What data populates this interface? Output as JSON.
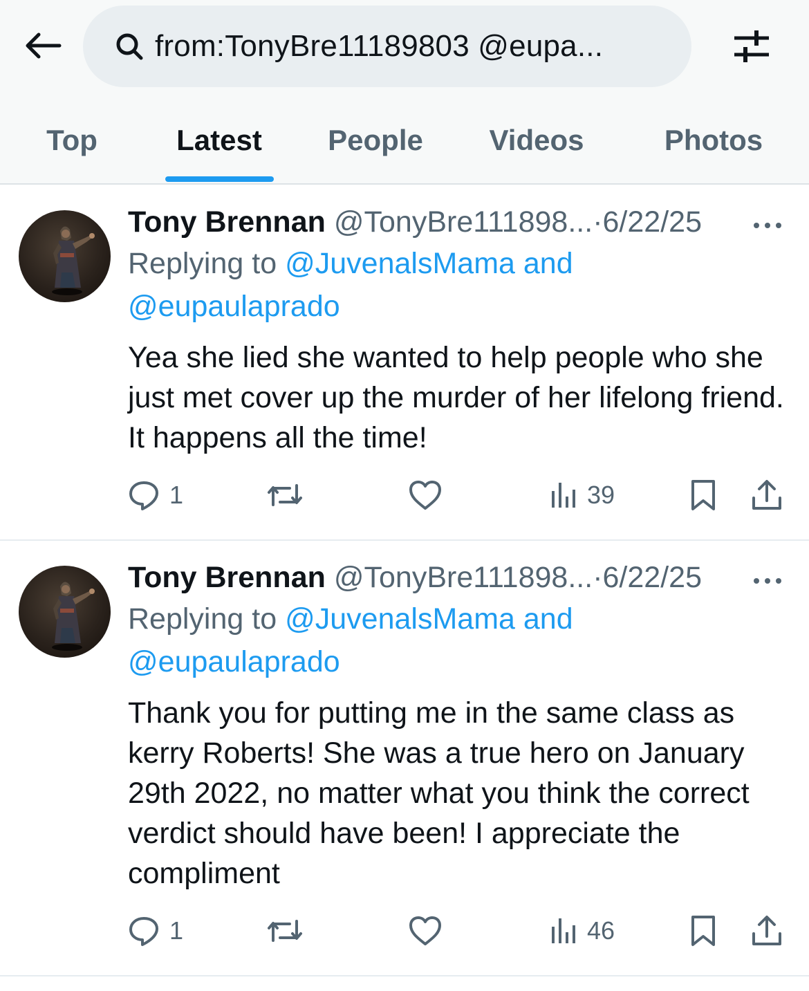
{
  "search": {
    "query": "from:TonyBre11189803 @eupa..."
  },
  "tabs": [
    {
      "label": "Top"
    },
    {
      "label": "Latest"
    },
    {
      "label": "People"
    },
    {
      "label": "Videos"
    },
    {
      "label": "Photos"
    }
  ],
  "active_tab": "Latest",
  "colors": {
    "accent": "#1d9bf0",
    "text_primary": "#0f1419",
    "text_secondary": "#536471",
    "search_bg": "#e9eef1"
  },
  "icons": [
    "back-arrow-icon",
    "search-icon",
    "filter-sliders-icon",
    "more-dots-icon",
    "reply-icon",
    "repost-icon",
    "like-icon",
    "views-icon",
    "bookmark-icon",
    "share-icon"
  ],
  "tweets": [
    {
      "author_name": "Tony Brennan",
      "handle": "@TonyBre111898...",
      "separator": "·",
      "date": "6/22/25",
      "replying_prefix": "Replying to",
      "replying_to_first": "@JuvenalsMama",
      "replying_and": "and",
      "replying_to_second": "@eupaulaprado",
      "text": "Yea she lied she wanted to help people who she just met cover up the murder of her lifelong friend. It happens all the time!",
      "replies": "1",
      "views": "39"
    },
    {
      "author_name": "Tony Brennan",
      "handle": "@TonyBre111898...",
      "separator": "·",
      "date": "6/22/25",
      "replying_prefix": "Replying to",
      "replying_to_first": "@JuvenalsMama",
      "replying_and": "and",
      "replying_to_second": "@eupaulaprado",
      "text": "Thank you for putting me in the same class as kerry Roberts! She was a true hero on January 29th 2022, no matter what you think the correct verdict should have been! I appreciate the compliment",
      "replies": "1",
      "views": "46"
    }
  ]
}
